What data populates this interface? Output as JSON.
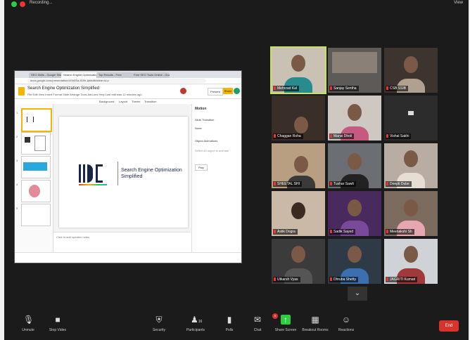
{
  "topbar": {
    "recording": "Recording...",
    "view": "View"
  },
  "browser": {
    "tabs": [
      "SEO Skills - Google Slides",
      "Search Engine Optimization",
      "Top Results - Free",
      "Free SEO Tools Online - Goo"
    ],
    "url": "docs.google.com/presentation/d/1h8Sa-t3Jfe-tjd/edit#slide=id.p"
  },
  "slides_app": {
    "doc_title": "Search Engine Optimization Simplified",
    "menu": "File  Edit  View  Insert  Format  Slide  Arrange  Tools  Add-ons  Help   Last edit was 12 minutes ago",
    "present": "Present",
    "share": "Share",
    "toolbar": [
      "Background",
      "Layout",
      "Theme",
      "Transition"
    ],
    "slide_title_line1": "Search Engine Optimization",
    "slide_title_line2": "Simplified",
    "speaker_notes": "Click to add speaker notes",
    "side_panel": {
      "title": "Motion",
      "section1": "Slide Transition",
      "option1": "None",
      "section2": "Object Animations",
      "hint": "Select an object to animate",
      "play": "Play"
    }
  },
  "participants": [
    {
      "name": "Mehrzad Kal"
    },
    {
      "name": "Sanjay Sentha"
    },
    {
      "name": "CSB SSIB"
    },
    {
      "name": "Chaggan Roha"
    },
    {
      "name": "Mansi Dholi"
    },
    {
      "name": "Vishal Sakhi"
    },
    {
      "name": "SHEETAL SHI"
    },
    {
      "name": "Tushar Sawli"
    },
    {
      "name": "Deepti Dube"
    },
    {
      "name": "Astik Dogra"
    },
    {
      "name": "Sadik Sayed"
    },
    {
      "name": "Meenakshi Sh"
    },
    {
      "name": "Utkarsh Vyas"
    },
    {
      "name": "Dhruba Shetty"
    },
    {
      "name": "JAGRITI Kumari"
    }
  ],
  "controls": {
    "unmute": "Unmute",
    "stop_video": "Stop Video",
    "security": "Security",
    "participants": "Participants",
    "participants_count": "16",
    "polls": "Polls",
    "chat": "Chat",
    "chat_badge": "9",
    "share_screen": "Share Screen",
    "breakout": "Breakout Rooms",
    "reactions": "Reactions",
    "end": "End"
  },
  "colors": {
    "zoom_bg": "#1b1b1b",
    "end_red": "#d9342b",
    "share_green": "#2ecc40",
    "active_speaker": "#c7e06a"
  }
}
